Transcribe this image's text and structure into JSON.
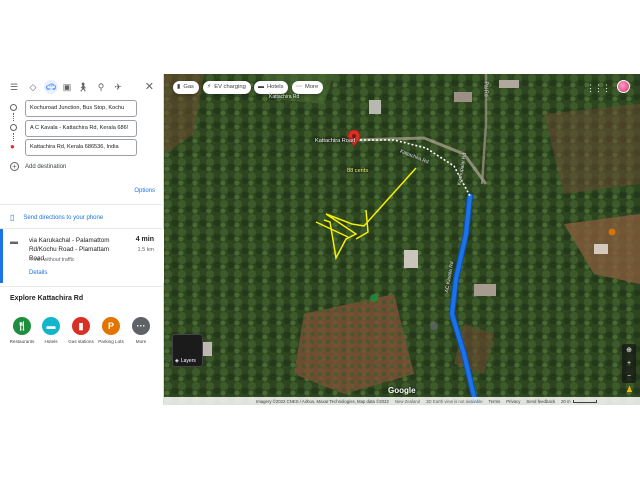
{
  "panel": {
    "travel_modes": [
      "menu-icon",
      "best-mode-icon",
      "car-icon",
      "transit-icon",
      "walk-icon",
      "bicycle-icon",
      "flight-icon"
    ],
    "stops": [
      {
        "value": "Kochuroad Junction, Bus Stop, Kochu"
      },
      {
        "value": "A C Kavala - Kattachira Rd, Kerala 686!"
      },
      {
        "value": "Kattachira Rd, Kerala 686536, India"
      }
    ],
    "add_destination": "Add destination",
    "options": "Options",
    "send_directions": "Send directions to your phone",
    "route": {
      "via": "via Karukachal - Palamattom Rd/Kochu Road - Plamattam Road",
      "time": "4 min",
      "distance": "1.5 km",
      "traffic": "4 min without traffic",
      "details": "Details"
    },
    "explore_title": "Explore Kattachira Rd",
    "categories": [
      {
        "label": "Restaurants",
        "color": "#1e8e3e",
        "icon": "restaurant-icon"
      },
      {
        "label": "Hotels",
        "color": "#12b5cb",
        "icon": "hotel-icon"
      },
      {
        "label": "Gas stations",
        "color": "#d93025",
        "icon": "gas-icon"
      },
      {
        "label": "Parking Lots",
        "color": "#e37400",
        "icon": "parking-icon"
      },
      {
        "label": "More",
        "color": "#5f6368",
        "icon": "more-icon"
      }
    ]
  },
  "map": {
    "chips": [
      "Gas",
      "EV charging",
      "Hotels",
      "More"
    ],
    "place_label": "Kattachira Road",
    "measure_label": "88 cents",
    "road_labels": [
      "Kattachira Rd",
      "Kattachira Rd",
      "Kochupalai Rd",
      "AC Kavala Rd",
      "Pal Rd"
    ],
    "layers": "Layers",
    "google": "Google",
    "footer": {
      "imagery": "Imagery ©2022 CNES / Airbus, Maxar Technologies, Map data ©2022",
      "country": "New Zealand",
      "earth_view": "3D Earth view is not available",
      "terms": "Terms",
      "privacy": "Privacy",
      "feedback": "Send feedback",
      "scale": "20 m"
    },
    "route_color": "#1a73e8",
    "measure_color": "#f5f000"
  }
}
